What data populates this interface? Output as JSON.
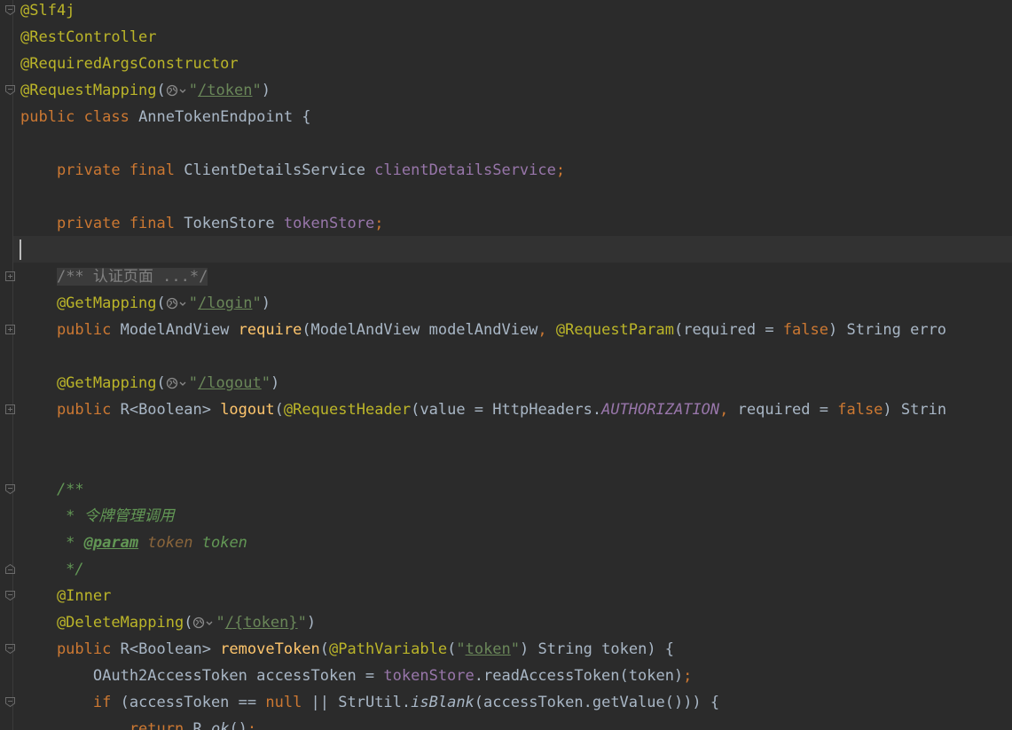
{
  "editor": {
    "lines": [
      [
        {
          "t": "@Slf4j",
          "c": "annotation"
        }
      ],
      [
        {
          "t": "@RestController",
          "c": "annotation"
        }
      ],
      [
        {
          "t": "@RequiredArgsConstructor",
          "c": "annotation"
        }
      ],
      [
        {
          "t": "@RequestMapping",
          "c": "annotation"
        },
        {
          "t": "(",
          "c": "plain"
        },
        {
          "icon": "globe-icon"
        },
        {
          "t": "\"",
          "c": "string"
        },
        {
          "t": "/token",
          "c": "string-link"
        },
        {
          "t": "\"",
          "c": "string"
        },
        {
          "t": ")",
          "c": "plain"
        }
      ],
      [
        {
          "t": "public class ",
          "c": "keyword"
        },
        {
          "t": "AnneTokenEndpoint {",
          "c": "plain"
        }
      ],
      [],
      [
        {
          "t": "    private final ",
          "c": "keyword"
        },
        {
          "t": "ClientDetailsService ",
          "c": "plain"
        },
        {
          "t": "clientDetailsService",
          "c": "field"
        },
        {
          "t": ";",
          "c": "keyword"
        }
      ],
      [],
      [
        {
          "t": "    private final ",
          "c": "keyword"
        },
        {
          "t": "TokenStore ",
          "c": "plain"
        },
        {
          "t": "tokenStore",
          "c": "field"
        },
        {
          "t": ";",
          "c": "keyword"
        }
      ],
      [],
      [
        {
          "t": "    ",
          "c": "plain"
        },
        {
          "t": "/** 认证页面 ...*/",
          "c": "comment-folded"
        }
      ],
      [
        {
          "t": "    @GetMapping",
          "c": "annotation"
        },
        {
          "t": "(",
          "c": "plain"
        },
        {
          "icon": "globe-icon"
        },
        {
          "t": "\"",
          "c": "string"
        },
        {
          "t": "/login",
          "c": "string-link"
        },
        {
          "t": "\"",
          "c": "string"
        },
        {
          "t": ")",
          "c": "plain"
        }
      ],
      [
        {
          "t": "    public ",
          "c": "keyword"
        },
        {
          "t": "ModelAndView ",
          "c": "plain"
        },
        {
          "t": "require",
          "c": "method"
        },
        {
          "t": "(ModelAndView modelAndView",
          "c": "plain"
        },
        {
          "t": ", ",
          "c": "keyword"
        },
        {
          "t": "@RequestParam",
          "c": "annotation"
        },
        {
          "t": "(required = ",
          "c": "plain"
        },
        {
          "t": "false",
          "c": "keyword"
        },
        {
          "t": ") String erro",
          "c": "plain"
        }
      ],
      [],
      [
        {
          "t": "    @GetMapping",
          "c": "annotation"
        },
        {
          "t": "(",
          "c": "plain"
        },
        {
          "icon": "globe-icon"
        },
        {
          "t": "\"",
          "c": "string"
        },
        {
          "t": "/logout",
          "c": "string-link"
        },
        {
          "t": "\"",
          "c": "string"
        },
        {
          "t": ")",
          "c": "plain"
        }
      ],
      [
        {
          "t": "    public ",
          "c": "keyword"
        },
        {
          "t": "R<Boolean> ",
          "c": "plain"
        },
        {
          "t": "logout",
          "c": "method"
        },
        {
          "t": "(",
          "c": "plain"
        },
        {
          "t": "@RequestHeader",
          "c": "annotation"
        },
        {
          "t": "(value = HttpHeaders.",
          "c": "plain"
        },
        {
          "t": "AUTHORIZATION",
          "c": "field-italic"
        },
        {
          "t": ", ",
          "c": "keyword"
        },
        {
          "t": "required = ",
          "c": "plain"
        },
        {
          "t": "false",
          "c": "keyword"
        },
        {
          "t": ") Strin",
          "c": "plain"
        }
      ],
      [],
      [],
      [
        {
          "t": "    /**",
          "c": "doc"
        }
      ],
      [
        {
          "t": "     * 令牌管理调用",
          "c": "doc"
        }
      ],
      [
        {
          "t": "     * ",
          "c": "doc"
        },
        {
          "t": "@param",
          "c": "doc-tag"
        },
        {
          "t": " token ",
          "c": "doc-param"
        },
        {
          "t": "token",
          "c": "doc"
        }
      ],
      [
        {
          "t": "     */",
          "c": "doc"
        }
      ],
      [
        {
          "t": "    @Inner",
          "c": "annotation"
        }
      ],
      [
        {
          "t": "    @DeleteMapping",
          "c": "annotation"
        },
        {
          "t": "(",
          "c": "plain"
        },
        {
          "icon": "globe-icon"
        },
        {
          "t": "\"",
          "c": "string"
        },
        {
          "t": "/{token}",
          "c": "string-link"
        },
        {
          "t": "\"",
          "c": "string"
        },
        {
          "t": ")",
          "c": "plain"
        }
      ],
      [
        {
          "t": "    public ",
          "c": "keyword"
        },
        {
          "t": "R<Boolean> ",
          "c": "plain"
        },
        {
          "t": "removeToken",
          "c": "method"
        },
        {
          "t": "(",
          "c": "plain"
        },
        {
          "t": "@PathVariable",
          "c": "annotation"
        },
        {
          "t": "(",
          "c": "plain"
        },
        {
          "t": "\"",
          "c": "string"
        },
        {
          "t": "token",
          "c": "string-link"
        },
        {
          "t": "\"",
          "c": "string"
        },
        {
          "t": ") String token) {",
          "c": "plain"
        }
      ],
      [
        {
          "t": "        OAuth2AccessToken accessToken = ",
          "c": "plain"
        },
        {
          "t": "tokenStore",
          "c": "field"
        },
        {
          "t": ".readAccessToken(token)",
          "c": "plain"
        },
        {
          "t": ";",
          "c": "keyword"
        }
      ],
      [
        {
          "t": "        if ",
          "c": "keyword"
        },
        {
          "t": "(accessToken == ",
          "c": "plain"
        },
        {
          "t": "null ",
          "c": "keyword"
        },
        {
          "t": "|| StrUtil.",
          "c": "plain"
        },
        {
          "t": "isBlank",
          "c": "static-call"
        },
        {
          "t": "(accessToken.getValue())) {",
          "c": "plain"
        }
      ],
      [
        {
          "t": "            return ",
          "c": "keyword"
        },
        {
          "t": "R.",
          "c": "plain"
        },
        {
          "t": "ok",
          "c": "static-call"
        },
        {
          "t": "()",
          "c": "plain"
        },
        {
          "t": ";",
          "c": "keyword"
        }
      ]
    ],
    "fold_markers": [
      {
        "line": 0,
        "kind": "open"
      },
      {
        "line": 3,
        "kind": "open"
      },
      {
        "line": 10,
        "kind": "collapsed"
      },
      {
        "line": 12,
        "kind": "collapsed"
      },
      {
        "line": 15,
        "kind": "collapsed"
      },
      {
        "line": 18,
        "kind": "open"
      },
      {
        "line": 21,
        "kind": "close"
      },
      {
        "line": 22,
        "kind": "open"
      },
      {
        "line": 24,
        "kind": "open"
      },
      {
        "line": 26,
        "kind": "open"
      }
    ],
    "current_line": 9,
    "colors": {
      "background": "#2b2b2b",
      "annotation": "#bbb529",
      "keyword": "#cc7832",
      "field": "#9876aa",
      "method": "#ffc66d",
      "string": "#6a8759",
      "plain": "#a9b7c6",
      "comment": "#808080",
      "doc": "#629755"
    }
  }
}
